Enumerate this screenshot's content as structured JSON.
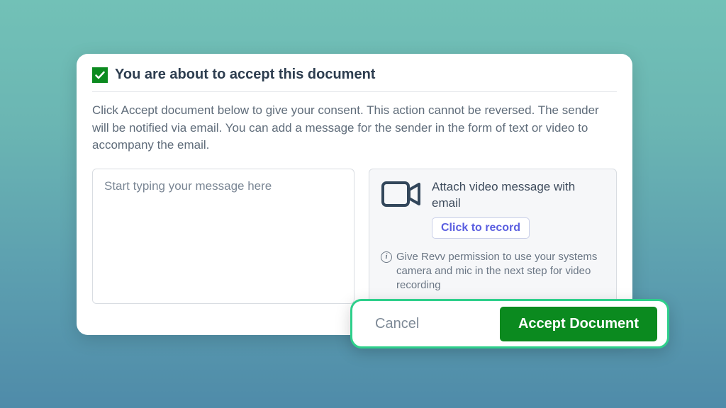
{
  "modal": {
    "title": "You are about to accept this document",
    "description": "Click Accept document below to give your consent. This action cannot be reversed. The sender will be notified via email. You can add a message for the sender in the form of text or video to accompany the email.",
    "message_placeholder": "Start typing your message here"
  },
  "video": {
    "title": "Attach video message with email",
    "record_label": "Click to record",
    "hint": "Give Revv permission to use your systems camera and mic in the next step for video recording"
  },
  "actions": {
    "cancel": "Cancel",
    "accept": "Accept Document"
  }
}
